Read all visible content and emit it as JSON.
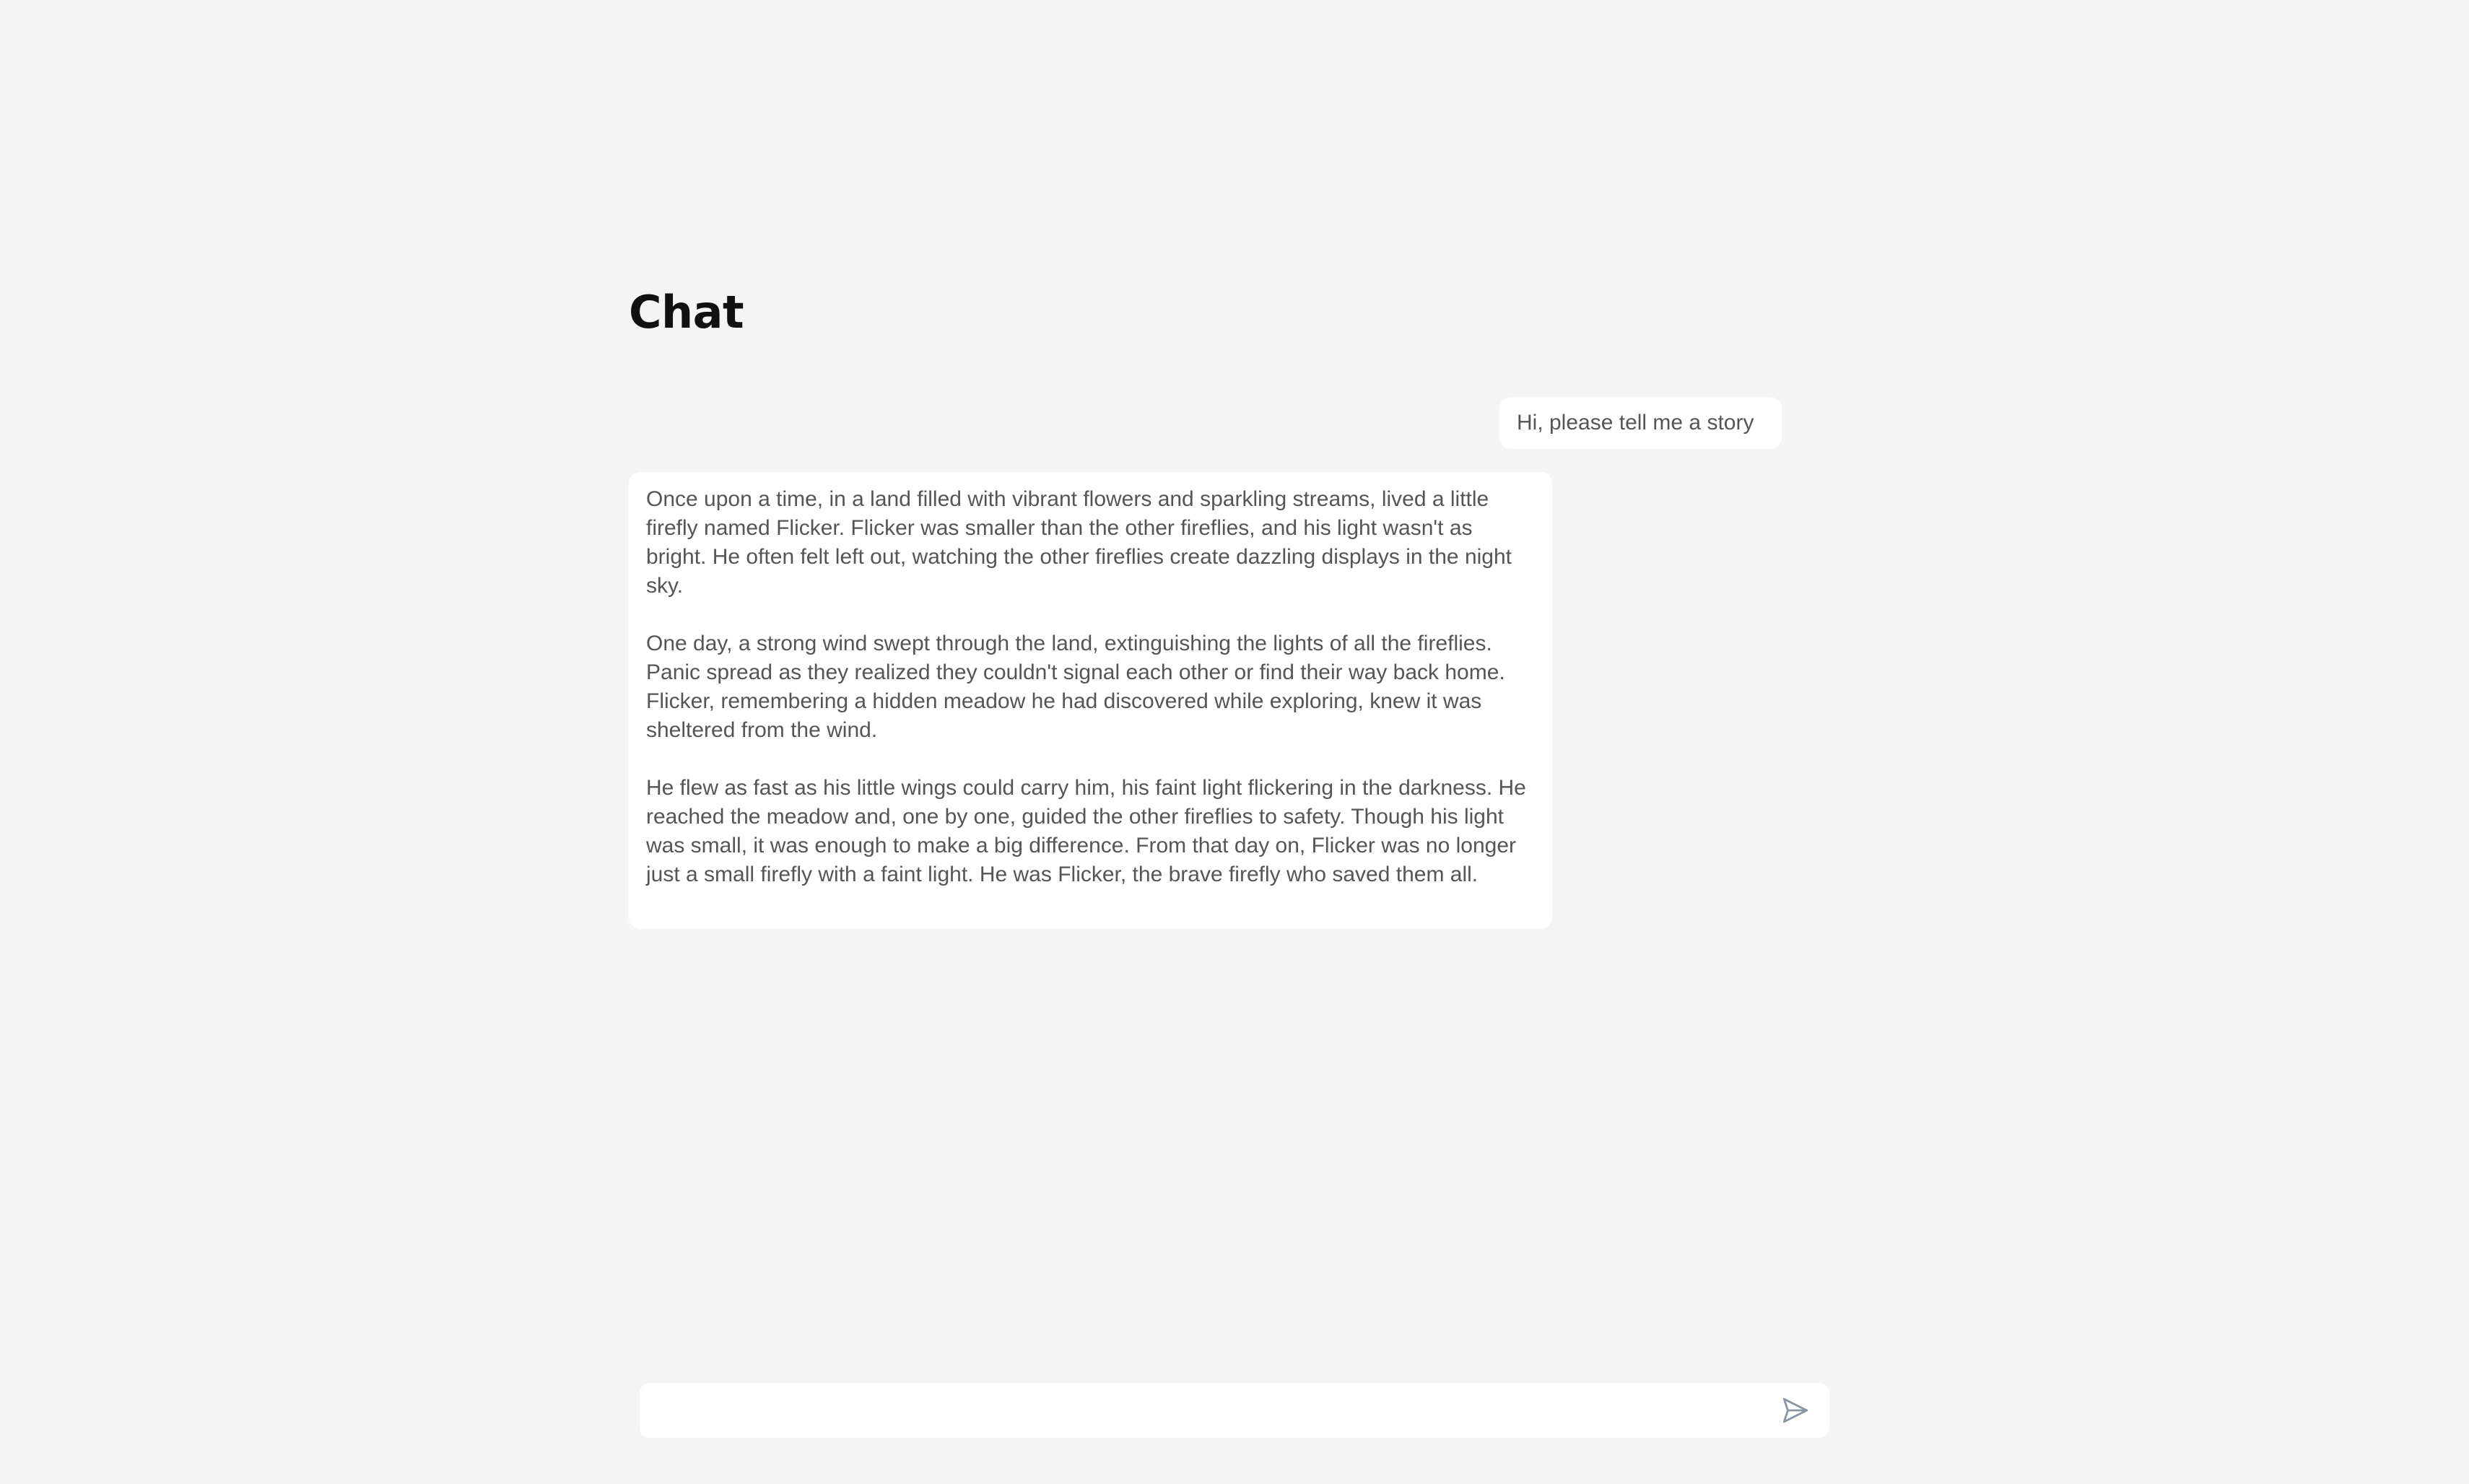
{
  "page": {
    "title": "Chat"
  },
  "conversation": {
    "messages": [
      {
        "role": "user",
        "text": "Hi, please tell me a story"
      },
      {
        "role": "assistant",
        "paragraphs": [
          "Once upon a time, in a land filled with vibrant flowers and sparkling streams, lived a little firefly named Flicker. Flicker was smaller than the other fireflies, and his light wasn't as bright. He often felt left out, watching the other fireflies create dazzling displays in the night sky.",
          "One day, a strong wind swept through the land, extinguishing the lights of all the fireflies. Panic spread as they realized they couldn't signal each other or find their way back home. Flicker, remembering a hidden meadow he had discovered while exploring, knew it was sheltered from the wind.",
          "He flew as fast as his little wings could carry him, his faint light flickering in the darkness. He reached the meadow and, one by one, guided the other fireflies to safety. Though his light was small, it was enough to make a big difference. From that day on, Flicker was no longer just a small firefly with a faint light. He was Flicker, the brave firefly who saved them all."
        ]
      }
    ]
  },
  "composer": {
    "value": "",
    "send_icon": "send-icon"
  },
  "colors": {
    "background": "#f5f5f5",
    "bubble": "#ffffff",
    "text": "#555555",
    "title": "#111111",
    "icon": "#8a96a3"
  }
}
